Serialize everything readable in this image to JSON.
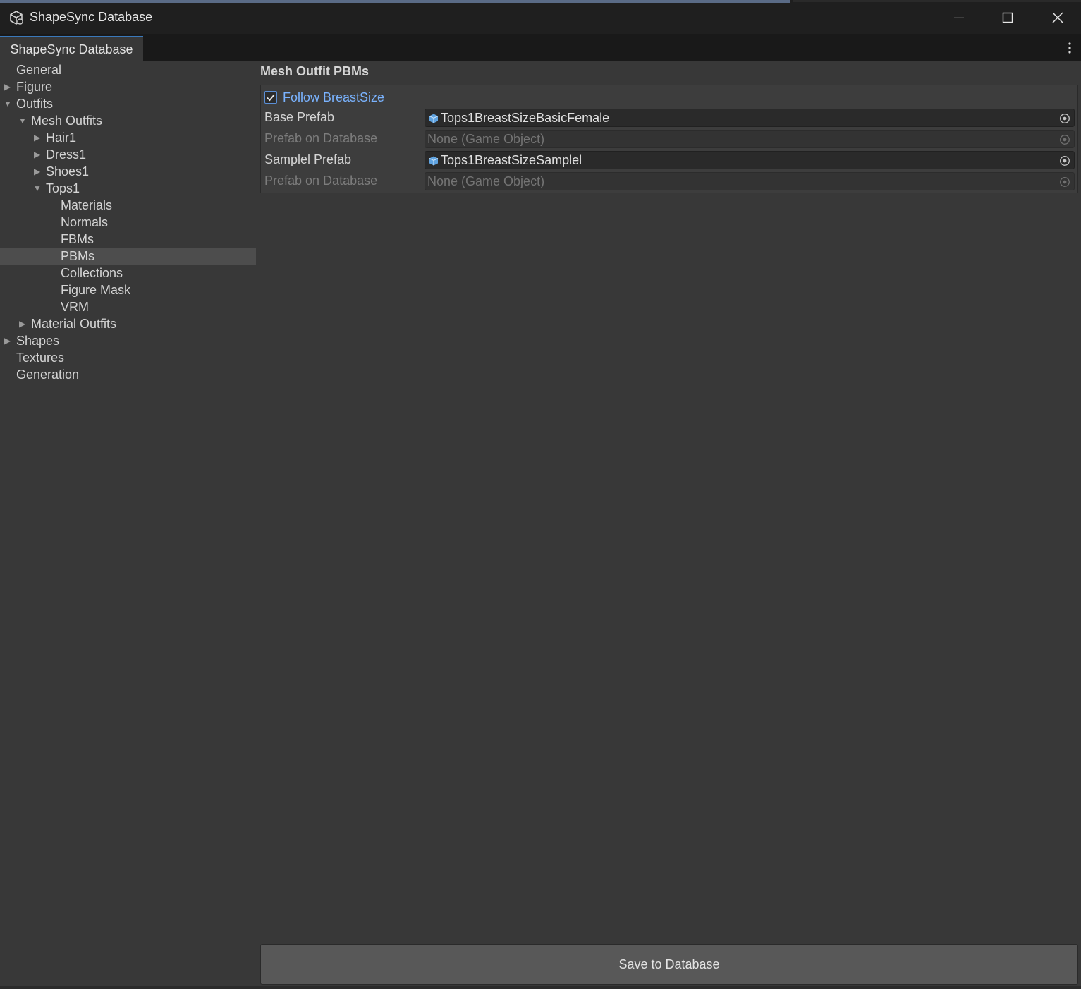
{
  "window": {
    "title": "ShapeSync Database",
    "icon": "unity-cube-icon"
  },
  "tabs": {
    "active_label": "ShapeSync Database"
  },
  "sidebar": {
    "items": [
      {
        "label": "General",
        "expander": "none"
      },
      {
        "label": "Figure",
        "expander": "collapsed"
      },
      {
        "label": "Outfits",
        "expander": "expanded"
      },
      {
        "label": "Mesh Outfits",
        "expander": "expanded"
      },
      {
        "label": "Hair1",
        "expander": "collapsed"
      },
      {
        "label": "Dress1",
        "expander": "collapsed"
      },
      {
        "label": "Shoes1",
        "expander": "collapsed"
      },
      {
        "label": "Tops1",
        "expander": "expanded"
      },
      {
        "label": "Materials",
        "expander": "none"
      },
      {
        "label": "Normals",
        "expander": "none"
      },
      {
        "label": "FBMs",
        "expander": "none"
      },
      {
        "label": "PBMs",
        "expander": "none",
        "selected": true
      },
      {
        "label": "Collections",
        "expander": "none"
      },
      {
        "label": "Figure Mask",
        "expander": "none"
      },
      {
        "label": "VRM",
        "expander": "none"
      },
      {
        "label": "Material Outfits",
        "expander": "collapsed"
      },
      {
        "label": "Shapes",
        "expander": "collapsed"
      },
      {
        "label": "Textures",
        "expander": "none"
      },
      {
        "label": "Generation",
        "expander": "none"
      }
    ]
  },
  "main": {
    "section_title": "Mesh Outfit PBMs",
    "follow_checkbox": {
      "label": "Follow BreastSize",
      "checked": true
    },
    "fields": [
      {
        "label": "Base Prefab",
        "value": "Tops1BreastSizeBasicFemale",
        "disabled": false
      },
      {
        "label": "Prefab on Database",
        "value": "None (Game Object)",
        "disabled": true
      },
      {
        "label": "Samplel Prefab",
        "value": "Tops1BreastSizeSamplel",
        "disabled": false
      },
      {
        "label": "Prefab on Database",
        "value": "None (Game Object)",
        "disabled": true
      }
    ],
    "save_button": "Save to Database"
  },
  "colors": {
    "background": "#383838",
    "accent": "#3a79bb",
    "checkbox_label": "#7ab3ff"
  }
}
